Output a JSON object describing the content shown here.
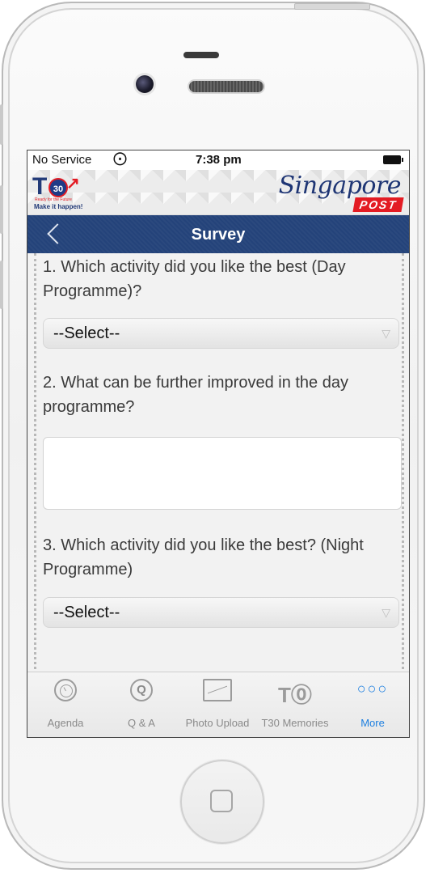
{
  "status_bar": {
    "carrier": "No Service",
    "time": "7:38 pm"
  },
  "brand": {
    "t30_number": "30",
    "t30_tagline": "Ready for the Future",
    "t30_slogan": "Make it happen!",
    "partner_script": "Singapore",
    "partner_post": "POST"
  },
  "nav": {
    "title": "Survey"
  },
  "survey": {
    "questions": [
      {
        "text": "1. Which activity did you like the best (Day Programme)?",
        "select_value": "--Select--"
      },
      {
        "text": "2. What can be further improved in the day programme?",
        "answer": ""
      },
      {
        "text": "3. Which activity did you like the best? (Night Programme)",
        "select_value": "--Select--"
      }
    ]
  },
  "tabs": [
    {
      "label": "Agenda",
      "icon": "clock-icon",
      "active": false
    },
    {
      "label": "Q & A",
      "icon": "q-icon",
      "active": false
    },
    {
      "label": "Photo Upload",
      "icon": "photo-icon",
      "active": false
    },
    {
      "label": "T30 Memories",
      "icon": "t30-icon",
      "active": false
    },
    {
      "label": "More",
      "icon": "more-dots-icon",
      "active": true
    }
  ],
  "colors": {
    "nav_bg": "#24437a",
    "active_tab": "#1d7fe0",
    "brand_red": "#e31b23"
  }
}
